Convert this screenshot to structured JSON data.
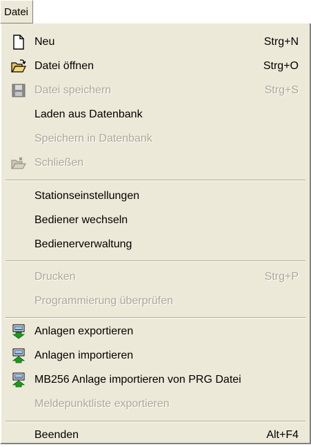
{
  "menubar": {
    "file_label": "Datei"
  },
  "menu": {
    "neu": {
      "label": "Neu",
      "shortcut": "Strg+N",
      "icon": "new-document-icon"
    },
    "oeffnen": {
      "label": "Datei öffnen",
      "shortcut": "Strg+O",
      "icon": "open-folder-icon"
    },
    "speichern": {
      "label": "Datei speichern",
      "shortcut": "Strg+S",
      "icon": "save-disk-icon"
    },
    "laden_db": {
      "label": "Laden aus Datenbank"
    },
    "speichern_db": {
      "label": "Speichern in Datenbank"
    },
    "schliessen": {
      "label": "Schließen",
      "icon": "close-folder-icon"
    },
    "stationseinstellungen": {
      "label": "Stationseinstellungen"
    },
    "bediener_wechseln": {
      "label": "Bediener wechseln"
    },
    "bedienerverwaltung": {
      "label": "Bedienerverwaltung"
    },
    "drucken": {
      "label": "Drucken",
      "shortcut": "Strg+P"
    },
    "programmierung": {
      "label": "Programmierung überprüfen"
    },
    "anlagen_export": {
      "label": "Anlagen exportieren",
      "icon": "computer-export-icon"
    },
    "anlagen_import": {
      "label": "Anlagen importieren",
      "icon": "computer-import-icon"
    },
    "mb256_import": {
      "label": "MB256 Anlage importieren von PRG Datei",
      "icon": "computer-import-icon"
    },
    "meldepunkt_export": {
      "label": "Meldepunktliste exportieren"
    },
    "beenden": {
      "label": "Beenden",
      "shortcut": "Alt+F4"
    }
  },
  "colors": {
    "menu_background": "#ece9d8",
    "disabled_text": "#aca899",
    "arrow_green": "#1c9a1c"
  }
}
